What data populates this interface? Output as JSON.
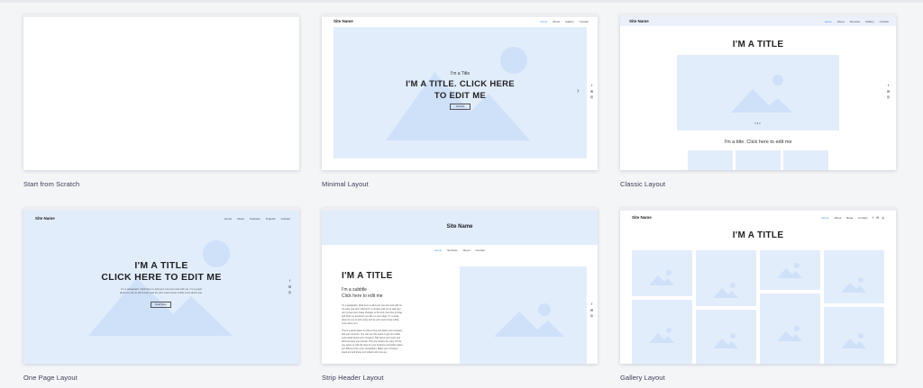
{
  "cards": [
    {
      "label": "Start from Scratch"
    },
    {
      "label": "Minimal Layout"
    },
    {
      "label": "Classic Layout"
    },
    {
      "label": "One Page Layout"
    },
    {
      "label": "Strip Header Layout"
    },
    {
      "label": "Gallery Layout"
    }
  ],
  "minimal": {
    "site_name": "Site Name",
    "nav": [
      "Home",
      "About",
      "Gallery",
      "Contact"
    ],
    "subtitle": "I'm a Title",
    "title_line1": "I'M A TITLE. CLICK HERE",
    "title_line2": "TO EDIT ME",
    "button": "Connect"
  },
  "classic": {
    "site_name": "Site Name",
    "nav": [
      "Home",
      "About",
      "Services",
      "Gallery",
      "Contact"
    ],
    "title": "I'M A TITLE",
    "dots": "•••",
    "caption": "I'm a title. Click here to edit me"
  },
  "onepage": {
    "site_name": "Site Name",
    "nav": [
      "Home",
      "About",
      "Features",
      "Projects",
      "Contact"
    ],
    "title_line1": "I'M A TITLE",
    "title_line2": "CLICK HERE TO EDIT ME",
    "para_line1": "I'm a paragraph. Click here to add your own text and edit me. I'm a great",
    "para_line2": "place for you to tell a story and let your users know a little more about you.",
    "button": "Read More"
  },
  "strip": {
    "site_name": "Site Name",
    "nav": [
      "Home",
      "Services",
      "About",
      "Contact"
    ],
    "title": "I'M A TITLE",
    "subtitle_line1": "I'm a subtitle",
    "subtitle_line2": "Click here to edit me",
    "para1": "I'm a paragraph. Click here to add your own text and edit me. It's easy, just click “Edit Text” or double click me to add your own content and make changes to the font. Feel free to drag and drop me anywhere you like on your page. I'm a great place for you to tell a story and let your users know a little more about you.",
    "para2": "This is a great space to write a long text about your company and your services. You can use this space to go into a little more detail about your company. Talk about your team and what services you provide. Tell your visitors the story of how you came up with the idea for your business and what makes you different from your competitors. Make your company stand out and show your visitors who you are."
  },
  "gallery": {
    "site_name": "Site Name",
    "nav": [
      "Home",
      "About",
      "Book",
      "Contact"
    ],
    "title": "I'M A TITLE"
  },
  "social": {
    "facebook": "f",
    "twitter": "✉",
    "instagram": "◎"
  },
  "colors": {
    "placeholder_bg": "#e2edfc",
    "placeholder_shape": "#cfe0f9",
    "accent": "#3f8cf4",
    "label": "#3b4057"
  }
}
